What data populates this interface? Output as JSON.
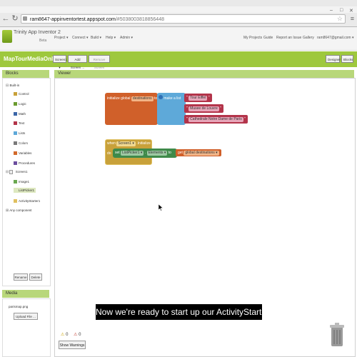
{
  "browser": {
    "tab_title": "ram8647-appinventortest.appspot.com/#5038003818856448",
    "url_domain": "ram8647-appinventortest.appspot.com",
    "url_path": "/#5038003818856448"
  },
  "app": {
    "title": "Trinity App Inventor 2",
    "subtitle": "Beta",
    "menus": [
      "Project ▾",
      "Connect ▾",
      "Build ▾",
      "Help ▾",
      "Admin ▾"
    ],
    "links": [
      "My Projects",
      "Guide",
      "Report an Issue",
      "Gallery",
      "ram8647@gmail.com ▾"
    ]
  },
  "toolbar": {
    "project_name": "MapTourMediaOnly",
    "screen_select": "Screen1 ▾",
    "add_screen": "Add Screen ...",
    "remove_screen": "Remove Screen",
    "designer": "Designer",
    "blocks": "Blocks"
  },
  "blocks_panel": {
    "header": "Blocks",
    "builtin": "Built-in",
    "builtin_items": [
      {
        "label": "Control",
        "color": "#c8a13a"
      },
      {
        "label": "Logic",
        "color": "#6b9b2f"
      },
      {
        "label": "Math",
        "color": "#3b66a8"
      },
      {
        "label": "Text",
        "color": "#b3344a"
      },
      {
        "label": "Lists",
        "color": "#5ea9d9"
      },
      {
        "label": "Colors",
        "color": "#7a7a7a"
      },
      {
        "label": "Variables",
        "color": "#d26a2c"
      },
      {
        "label": "Procedures",
        "color": "#6c4e9e"
      }
    ],
    "screen": "Screen1",
    "components": [
      "Image1",
      "ListPicker1",
      "ActivityStarter1"
    ],
    "any_component": "Any component",
    "rename": "Rename",
    "delete": "Delete"
  },
  "media_panel": {
    "header": "Media",
    "file": "parismap.png",
    "upload": "Upload File ..."
  },
  "viewer": {
    "header": "Viewer",
    "global_block": {
      "initialize_global": "initialize global",
      "var_name": "destinations",
      "to": "to",
      "make_a_list": "make a list",
      "items": [
        "Tour Eiffel",
        "Musee de Louvre",
        "Cathedrale Notre Dame de Paris"
      ]
    },
    "event_block": {
      "when": "when",
      "screen": "Screen1 ▾",
      "initialize": ".Initialize",
      "do": "do",
      "set": "set",
      "component": "ListPicker1 ▾",
      "property": "Elements ▾",
      "to": "to",
      "get": "get",
      "get_var": "global destinations ▾"
    },
    "warnings_count": "0",
    "errors_count": "0",
    "show_warnings": "Show Warnings"
  },
  "subtitle_text": "Now we're ready to start up our ActivityStarter."
}
